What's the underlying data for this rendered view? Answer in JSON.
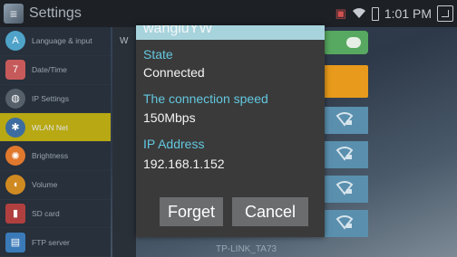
{
  "statusbar": {
    "title": "Settings",
    "time": "1:01 PM",
    "icons": [
      "notification-icon",
      "wifi-icon",
      "battery-icon",
      "screenshot-icon"
    ]
  },
  "sidebar": {
    "items": [
      {
        "label": "Language & input",
        "icon": "language-icon",
        "color": "#4fa3c9",
        "glyph": "A"
      },
      {
        "label": "Date/Time",
        "icon": "calendar-icon",
        "color": "#c65a5a",
        "glyph": "7"
      },
      {
        "label": "IP Settings",
        "icon": "globe-icon",
        "color": "#56606a",
        "glyph": "◍"
      },
      {
        "label": "WLAN Net",
        "icon": "wlan-icon",
        "color": "#3d6da0",
        "glyph": "✱",
        "active": true
      },
      {
        "label": "Brightness",
        "icon": "brightness-icon",
        "color": "#e0782e",
        "glyph": "✺"
      },
      {
        "label": "Volume",
        "icon": "volume-icon",
        "color": "#d08a22",
        "glyph": "◖"
      },
      {
        "label": "SD card",
        "icon": "sdcard-icon",
        "color": "#b04040",
        "glyph": "▮"
      },
      {
        "label": "FTP server",
        "icon": "ftp-icon",
        "color": "#3b7ab8",
        "glyph": "▤"
      }
    ]
  },
  "middle": {
    "letter": "W"
  },
  "list": {
    "partial_ssid": "TP-LINK_TA73"
  },
  "dialog": {
    "ssid": "wangluYW",
    "state_label": "State",
    "state_value": "Connected",
    "speed_label": "The connection speed",
    "speed_value": "150Mbps",
    "ip_label": "IP Address",
    "ip_value": "192.168.1.152",
    "forget_label": "Forget",
    "cancel_label": "Cancel"
  }
}
